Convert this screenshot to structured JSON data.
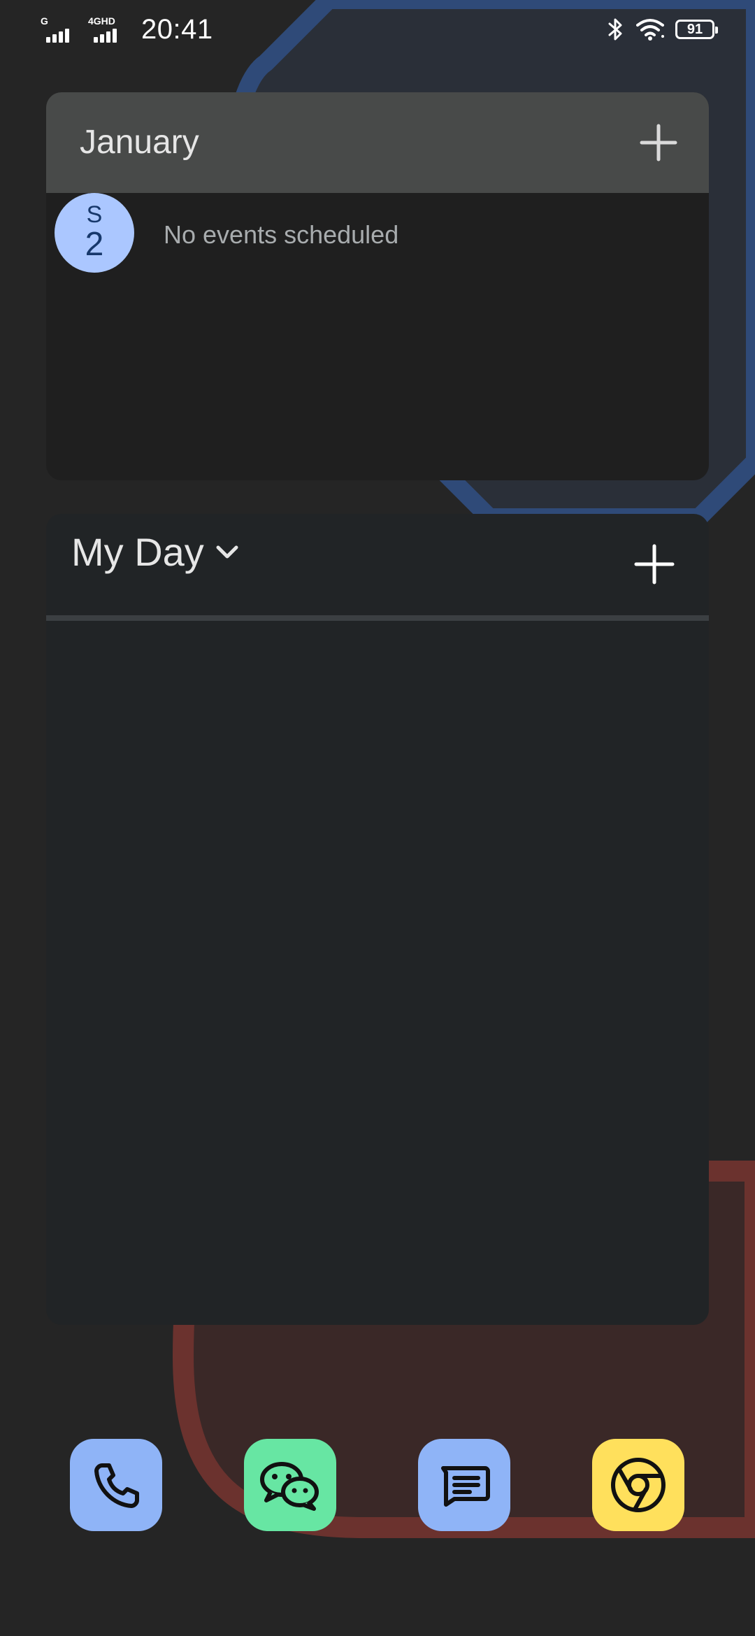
{
  "status_bar": {
    "time": "20:41",
    "sim1_network": "G",
    "sim2_network": "4GHD",
    "battery": "91",
    "icons": [
      "bluetooth-icon",
      "wifi-icon",
      "battery-icon"
    ]
  },
  "calendar_widget": {
    "month": "January",
    "add_icon": "plus-icon",
    "date": {
      "day_of_week": "S",
      "day": "2"
    },
    "empty_message": "No events scheduled"
  },
  "myday_widget": {
    "title": "My Day",
    "dropdown_icon": "chevron-down-icon",
    "add_icon": "plus-icon",
    "items": []
  },
  "dock": {
    "apps": [
      {
        "icon": "phone-icon",
        "color": "#8fb4f7"
      },
      {
        "icon": "wechat-icon",
        "color": "#67e6a3"
      },
      {
        "icon": "messages-icon",
        "color": "#8fb4f7"
      },
      {
        "icon": "chrome-icon",
        "color": "#ffe05c"
      }
    ]
  },
  "colors": {
    "background": "#252525",
    "calendar_header": "#484a49",
    "calendar_body": "#1f1f1f",
    "myday_body": "#212426",
    "date_badge": "#abc7ff",
    "wallpaper_blue": "#2f4a78",
    "wallpaper_red": "#6b322e"
  }
}
